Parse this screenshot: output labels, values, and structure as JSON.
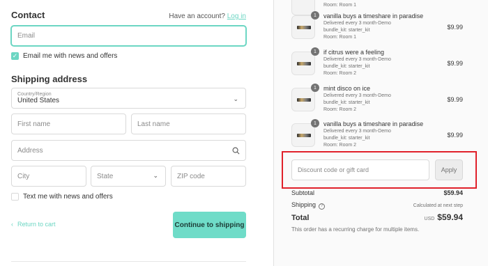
{
  "contact": {
    "heading": "Contact",
    "have_account": "Have an account?",
    "login_link": "Log in",
    "email_placeholder": "Email",
    "email_opt_in": "Email me with news and offers",
    "email_opt_in_checked": true
  },
  "shipping": {
    "heading": "Shipping address",
    "country_label": "Country/Region",
    "country_value": "United States",
    "first_name_placeholder": "First name",
    "last_name_placeholder": "Last name",
    "address_placeholder": "Address",
    "city_placeholder": "City",
    "state_placeholder": "State",
    "zip_placeholder": "ZIP code",
    "sms_opt_in": "Text me with news and offers",
    "sms_opt_in_checked": false
  },
  "nav": {
    "return_label": "Return to cart",
    "continue_label": "Continue to shipping"
  },
  "order": {
    "top_partial_room": "Room: Room 1",
    "items": [
      {
        "qty": "1",
        "name": "vanilla buys a timeshare in paradise",
        "delivery": "Delivered every 3 month-Demo",
        "bundle": "bundle_kit: starter_kit",
        "room": "Room: Room 1",
        "price": "$9.99"
      },
      {
        "qty": "1",
        "name": "if citrus were a feeling",
        "delivery": "Delivered every 3 month-Demo",
        "bundle": "bundle_kit: starter_kit",
        "room": "Room: Room 2",
        "price": "$9.99"
      },
      {
        "qty": "1",
        "name": "mint disco on ice",
        "delivery": "Delivered every 3 month-Demo",
        "bundle": "bundle_kit: starter_kit",
        "room": "Room: Room 2",
        "price": "$9.99"
      },
      {
        "qty": "1",
        "name": "vanilla buys a timeshare in paradise",
        "delivery": "Delivered every 3 month-Demo",
        "bundle": "bundle_kit: starter_kit",
        "room": "Room: Room 2",
        "price": "$9.99"
      }
    ],
    "discount_placeholder": "Discount code or gift card",
    "apply_label": "Apply",
    "subtotal_label": "Subtotal",
    "subtotal_value": "$59.94",
    "shipping_label": "Shipping",
    "shipping_value": "Calculated at next step",
    "total_label": "Total",
    "currency": "USD",
    "total_value": "$59.94",
    "recurring_note": "This order has a recurring charge for multiple items."
  },
  "colors": {
    "accent": "#6cd6c3",
    "highlight_box": "#e0202a"
  }
}
